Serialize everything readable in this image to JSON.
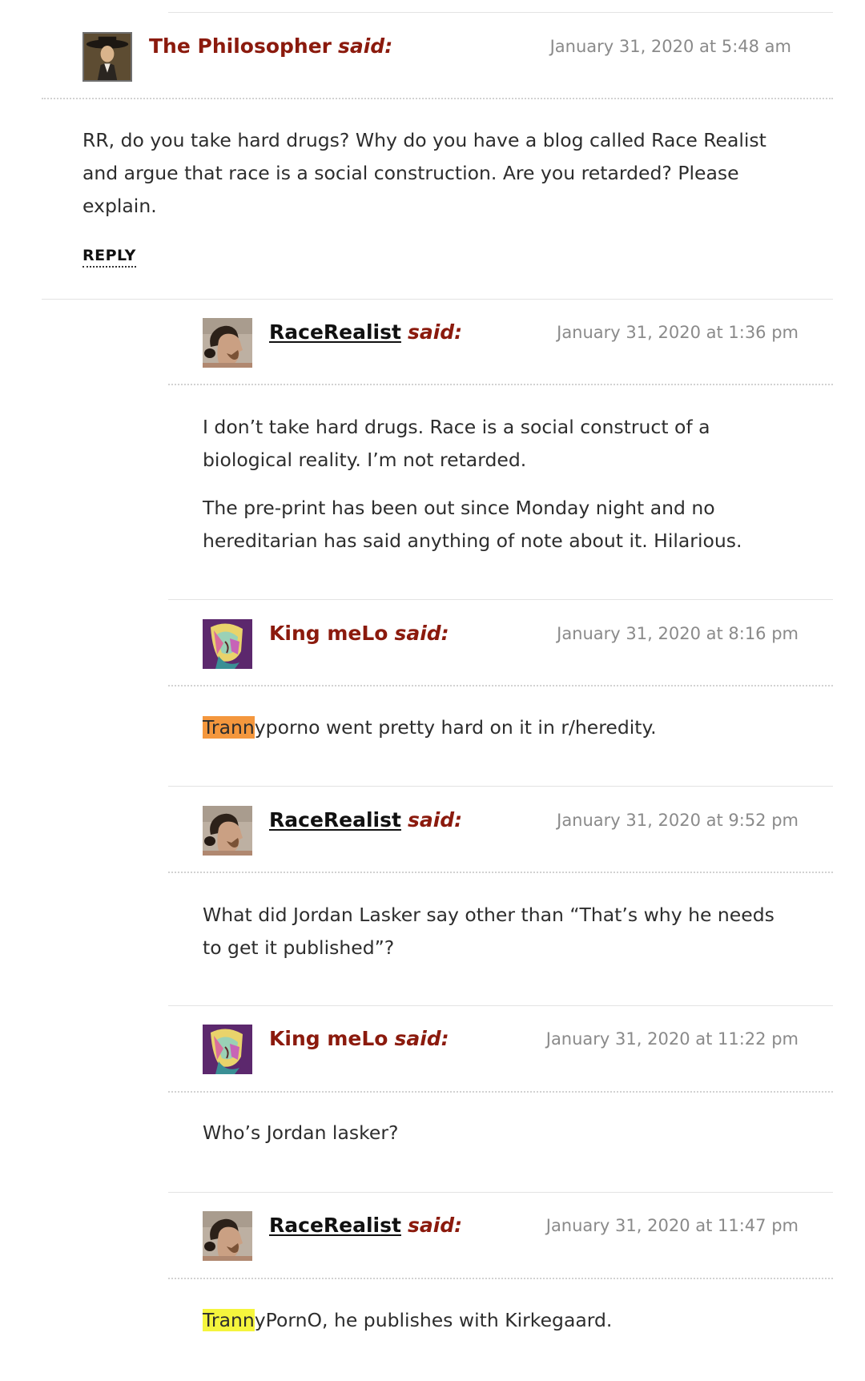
{
  "comments": [
    {
      "author": "The Philosopher",
      "said": "said:",
      "date": "January 31, 2020 at 5:48 am",
      "avatar": "portrait-hat-icon",
      "paragraphs": [
        "RR, do you take hard drugs? Why do you have a blog called Race Realist and argue that race is a social construction. Are you retarded? Please explain."
      ],
      "reply_label": "REPLY"
    },
    {
      "author": "RaceRealist",
      "said": "said:",
      "date": "January 31, 2020 at 1:36 pm",
      "avatar": "man-profile-photo",
      "paragraphs": [
        "I don’t take hard drugs. Race is a social construct of a biological reality. I’m not retarded.",
        "The pre-print has been out since Monday night and no hereditarian has said anything of note about it. Hilarious."
      ]
    },
    {
      "author": "King meLo",
      "said": "said:",
      "date": "January 31, 2020 at 8:16 pm",
      "avatar": "abstract-face-art",
      "highlight": "Trann",
      "rest": "yporno went pretty hard on it in r/heredity."
    },
    {
      "author": "RaceRealist",
      "said": "said:",
      "date": "January 31, 2020 at 9:52 pm",
      "avatar": "man-profile-photo",
      "paragraphs": [
        "What did Jordan Lasker say other than “That’s why he needs to get it published”?"
      ]
    },
    {
      "author": "King meLo",
      "said": "said:",
      "date": "January 31, 2020 at 11:22 pm",
      "avatar": "abstract-face-art",
      "paragraphs": [
        "Who’s Jordan lasker?"
      ]
    },
    {
      "author": "RaceRealist",
      "said": "said:",
      "date": "January 31, 2020 at 11:47 pm",
      "avatar": "man-profile-photo",
      "highlight": "Trann",
      "rest": "yPornO, he publishes with Kirkegaard."
    }
  ],
  "colors": {
    "author": "#8b1a0d",
    "timestamp": "#8a8a8a",
    "highlight_orange": "#f4973d",
    "highlight_yellow": "#f5f53d"
  }
}
